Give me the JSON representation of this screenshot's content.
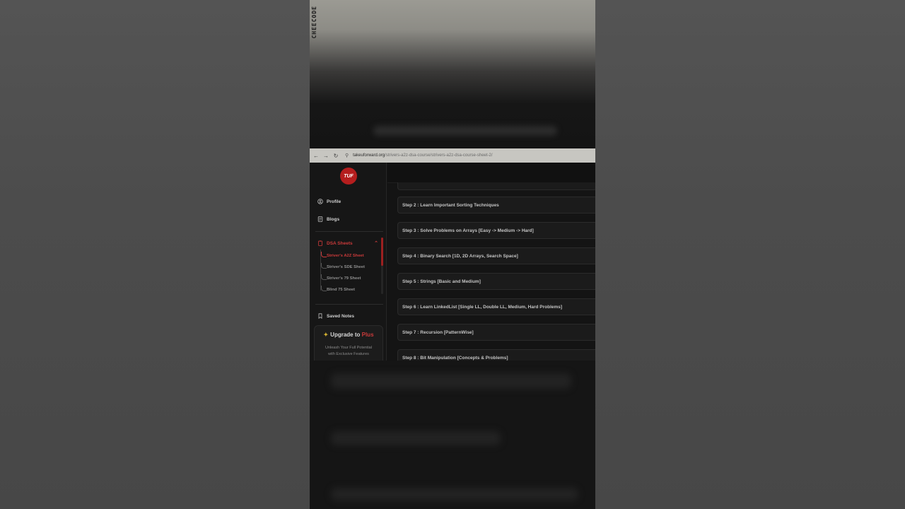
{
  "watermark": "CHEECODE",
  "browser": {
    "back_icon": "arrow-left-icon",
    "forward_icon": "arrow-right-icon",
    "reload_icon": "reload-icon",
    "url_domain": "takeuforward.org",
    "url_path": "/strivers-a2z-dsa-course/strivers-a2z-dsa-course-sheet-2/"
  },
  "sidebar": {
    "logo": "TUF",
    "profile": "Profile",
    "blogs": "Blogs",
    "dsa_sheets": "DSA Sheets",
    "sheets": [
      {
        "label": "Striver's A2Z Sheet",
        "active": true
      },
      {
        "label": "Striver's SDE Sheet",
        "active": false
      },
      {
        "label": "Striver's 79 Sheet",
        "active": false
      },
      {
        "label": "Blind 75 Sheet",
        "active": false
      }
    ],
    "saved_notes": "Saved Notes",
    "upgrade": {
      "title_prefix": "Upgrade to ",
      "title_plus": "Plus",
      "subtitle_line1": "Unleash Your Full Potential",
      "subtitle_line2": "with Exclusive Features"
    }
  },
  "steps": [
    "Step 2 : Learn Important Sorting Techniques",
    "Step 3 : Solve Problems on Arrays [Easy -> Medium -> Hard]",
    "Step 4 : Binary Search [1D, 2D Arrays, Search Space]",
    "Step 5 : Strings [Basic and Medium]",
    "Step 6 : Learn LinkedList [Single LL, Double LL, Medium, Hard Problems]",
    "Step 7 : Recursion [PatternWise]",
    "Step 8 : Bit Manipulation [Concepts & Problems]"
  ],
  "colors": {
    "accent": "#c93a3a",
    "logo_bg": "#b51e1e",
    "spark": "#d8b431"
  }
}
